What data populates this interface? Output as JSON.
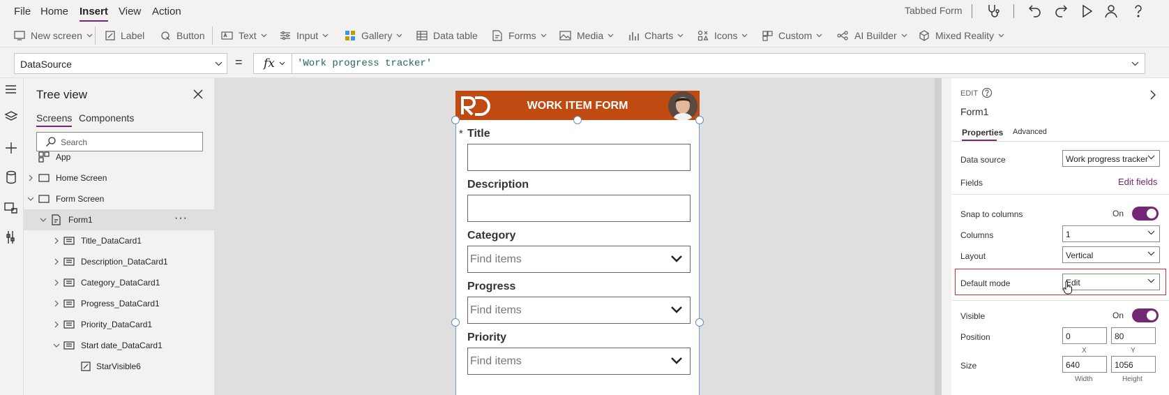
{
  "menubar": {
    "items": [
      "File",
      "Home",
      "Insert",
      "View",
      "Action"
    ],
    "active": "Insert",
    "app_name": "Tabbed Form"
  },
  "toolbar": {
    "new_screen": "New screen",
    "label": "Label",
    "button": "Button",
    "text": "Text",
    "input": "Input",
    "gallery": "Gallery",
    "data_table": "Data table",
    "forms": "Forms",
    "media": "Media",
    "charts": "Charts",
    "icons": "Icons",
    "custom": "Custom",
    "ai_builder": "AI Builder",
    "mixed_reality": "Mixed Reality"
  },
  "formula_bar": {
    "property": "DataSource",
    "equals": "=",
    "fx": "fx",
    "formula": "'Work progress tracker'"
  },
  "tree_view": {
    "title": "Tree view",
    "tabs": [
      "Screens",
      "Components"
    ],
    "search_placeholder": "Search",
    "items": {
      "app": "App",
      "home_screen": "Home Screen",
      "form_screen": "Form Screen",
      "form1": "Form1",
      "title_card": "Title_DataCard1",
      "description_card": "Description_DataCard1",
      "category_card": "Category_DataCard1",
      "progress_card": "Progress_DataCard1",
      "priority_card": "Priority_DataCard1",
      "start_date_card": "Start date_DataCard1",
      "star_visible": "StarVisible6"
    },
    "more": "···"
  },
  "canvas": {
    "header_title": "WORK ITEM FORM",
    "required_mark": "*",
    "fields": {
      "title": "Title",
      "description": "Description",
      "category": "Category",
      "progress": "Progress",
      "priority": "Priority"
    },
    "combo_placeholder": "Find items",
    "colors": {
      "header": "#bf4a12",
      "selection": "#6d9bd1"
    }
  },
  "properties": {
    "mode": "EDIT",
    "control": "Form1",
    "tabs": [
      "Properties",
      "Advanced"
    ],
    "data_source_label": "Data source",
    "data_source_value": "Work progress tracker",
    "fields_label": "Fields",
    "edit_fields": "Edit fields",
    "snap_label": "Snap to columns",
    "snap_value": "On",
    "columns_label": "Columns",
    "columns_value": "1",
    "layout_label": "Layout",
    "layout_value": "Vertical",
    "default_mode_label": "Default mode",
    "default_mode_value": "Edit",
    "visible_label": "Visible",
    "visible_value": "On",
    "position_label": "Position",
    "position_x": "0",
    "position_y": "80",
    "x_label": "X",
    "y_label": "Y",
    "size_label": "Size",
    "size_width": "640",
    "size_height": "1056",
    "width_label": "Width",
    "height_label": "Height",
    "accent": "#742774",
    "highlight": "#d13438"
  }
}
